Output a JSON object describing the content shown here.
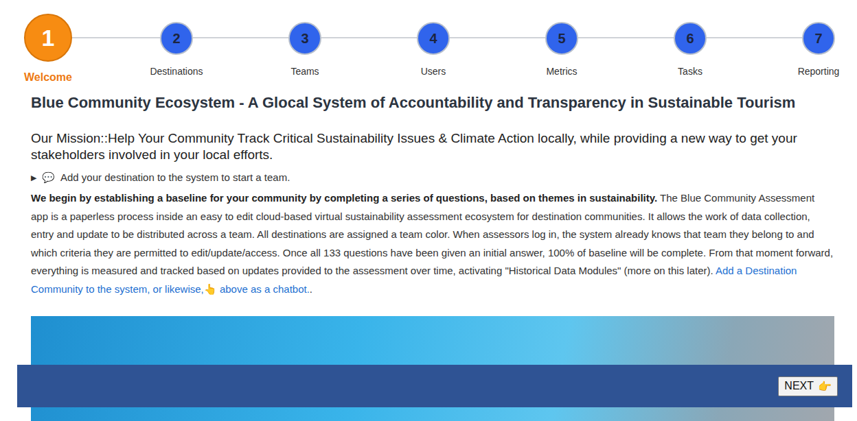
{
  "steps": [
    {
      "number": "1",
      "label": "Welcome",
      "selected": true
    },
    {
      "number": "2",
      "label": "Destinations",
      "selected": false
    },
    {
      "number": "3",
      "label": "Teams",
      "selected": false
    },
    {
      "number": "4",
      "label": "Users",
      "selected": false
    },
    {
      "number": "5",
      "label": "Metrics",
      "selected": false
    },
    {
      "number": "6",
      "label": "Tasks",
      "selected": false
    },
    {
      "number": "7",
      "label": "Reporting",
      "selected": false
    }
  ],
  "heading": "Blue Community Ecosystem - A Glocal System of Accountability and Transparency in Sustainable Tourism",
  "mission": "Our Mission::Help Your Community Track Critical Sustainability Issues & Climate Action locally, while providing a new way to get your stakeholders involved in your local efforts.",
  "details": {
    "marker": "▶",
    "icon": "💬",
    "summary": "Add your destination to the system to start a team.",
    "expanded": false
  },
  "paragraph": {
    "lead": "We begin by establishing a baseline for your community by completing a series of questions, based on themes in sustainability.",
    "body": " The Blue Community Assessment app is a paperless process inside an easy to edit cloud-based virtual sustainability assessment ecosystem for destination communities. It allows the work of data collection, entry and update to be distributed across a team. All destinations are assigned a team color. When assessors log in, the system already knows that team they belong to and which criteria they are permitted to edit/update/access. Once all 133 questions have been given an initial answer, 100% of baseline will be complete. From that moment forward, everything is measured and tracked based on updates provided to the assessment over time, activating \"Historical Data Modules\" (more on this later).",
    "link1": "Add a Destination Community to the system, or likewise,",
    "pointer": "👆",
    "link2": "above as a chatbot.",
    "tail": "."
  },
  "footer": {
    "button": "NEXT",
    "button_icon": "👉"
  }
}
